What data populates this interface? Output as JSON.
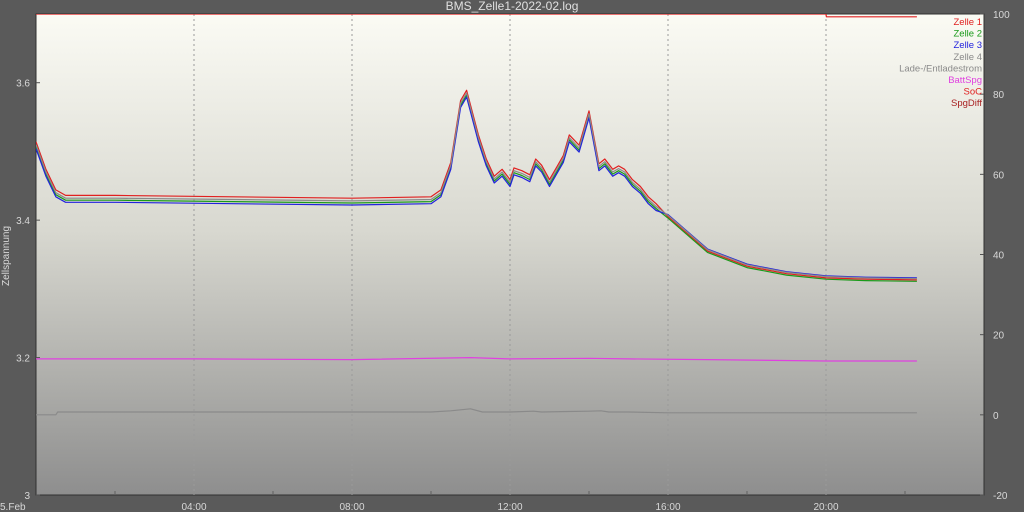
{
  "chart_data": {
    "type": "line",
    "title": "BMS_Zelle1-2022-02.log",
    "ylabel": "Zellspannung",
    "x_start_label": "5.Feb",
    "x_tick_labels": [
      "04:00",
      "08:00",
      "12:00",
      "16:00",
      "20:00"
    ],
    "x_range_hours": [
      0,
      24
    ],
    "x_ticks_hours": [
      4,
      8,
      12,
      16,
      20
    ],
    "y_left": {
      "lim": [
        3.0,
        3.7
      ],
      "ticks": [
        3,
        3.2,
        3.4,
        3.6
      ],
      "tick_labels": [
        "3",
        "3.2",
        "3.4",
        "3.6"
      ]
    },
    "y_right": {
      "lim": [
        -20,
        100
      ],
      "ticks": [
        -20,
        0,
        20,
        40,
        60,
        80,
        100
      ],
      "tick_labels": [
        "-20",
        "0",
        "20",
        "40",
        "60",
        "80",
        "100"
      ]
    },
    "cell_x": [
      0,
      0.25,
      0.5,
      0.75,
      2,
      5,
      8,
      10,
      10.25,
      10.5,
      10.75,
      10.9,
      11.2,
      11.4,
      11.6,
      11.8,
      12.0,
      12.1,
      12.3,
      12.5,
      12.65,
      12.8,
      13.0,
      13.2,
      13.35,
      13.5,
      13.75,
      14.0,
      14.25,
      14.4,
      14.6,
      14.75,
      14.9,
      15.1,
      15.3,
      15.5,
      15.7,
      16.0,
      16.5,
      17,
      18,
      19,
      20,
      21,
      22.3
    ],
    "cell_base": [
      3.51,
      3.47,
      3.44,
      3.432,
      3.432,
      3.43,
      3.428,
      3.43,
      3.44,
      3.48,
      3.57,
      3.585,
      3.52,
      3.485,
      3.46,
      3.47,
      3.455,
      3.472,
      3.468,
      3.462,
      3.485,
      3.476,
      3.455,
      3.475,
      3.49,
      3.52,
      3.505,
      3.555,
      3.478,
      3.485,
      3.47,
      3.475,
      3.47,
      3.455,
      3.445,
      3.43,
      3.42,
      3.405,
      3.38,
      3.355,
      3.333,
      3.322,
      3.316,
      3.314,
      3.313
    ],
    "series": [
      {
        "name": "Zelle 1",
        "color": "#e02020",
        "offset": 0.004,
        "late_offset": 0.0
      },
      {
        "name": "Zelle 2",
        "color": "#1a9a1a",
        "offset": -0.003,
        "late_offset": -0.002
      },
      {
        "name": "Zelle 3",
        "color": "#2222dd",
        "offset": -0.006,
        "late_offset": 0.003
      },
      {
        "name": "Zelle 4",
        "color": "#8a8a8a",
        "offset": 0.0,
        "late_offset": 0.002
      },
      {
        "name": "Lade-/Entladestrom",
        "color": "#8a8a8a",
        "axis": "right",
        "x": [
          0,
          0.5,
          0.55,
          10,
          10.5,
          11,
          11.3,
          11.6,
          12,
          12.6,
          12.8,
          13.3,
          14,
          14.3,
          14.5,
          15,
          16,
          22.3
        ],
        "y": [
          0,
          0,
          0.7,
          0.7,
          1.0,
          1.5,
          0.7,
          0.7,
          0.7,
          0.9,
          0.7,
          0.8,
          0.9,
          1.0,
          0.7,
          0.7,
          0.5,
          0.5
        ]
      },
      {
        "name": "BattSpg",
        "color": "#e040e0",
        "axis": "left",
        "x": [
          0,
          4,
          8,
          11,
          12,
          14,
          15,
          17,
          20,
          22.3
        ],
        "y": [
          3.198,
          3.198,
          3.197,
          3.2,
          3.198,
          3.199,
          3.198,
          3.197,
          3.195,
          3.195
        ]
      },
      {
        "name": "SoC",
        "color": "#e02020",
        "axis": "right",
        "x": [
          0,
          20,
          20.01,
          22.3
        ],
        "y": [
          100,
          100,
          99.3,
          99.3
        ]
      },
      {
        "name": "SpgDiff",
        "color": "#a82020"
      }
    ]
  }
}
